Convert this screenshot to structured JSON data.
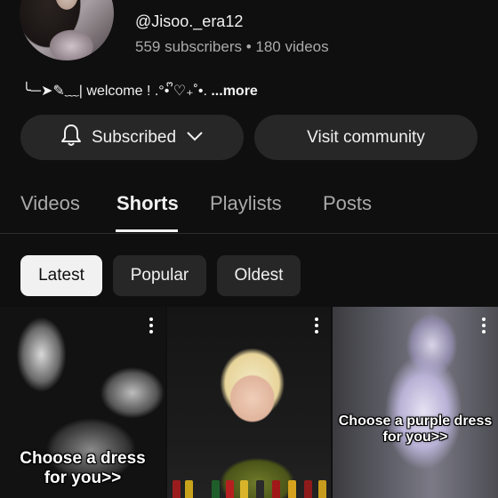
{
  "channel": {
    "handle": "@Jisoo._era12",
    "stats": "559 subscribers • 180 videos",
    "description": "╰─➤✎﹏| welcome ! .°• ᩚ♡₊˚•. ",
    "more_label": "...more"
  },
  "actions": {
    "subscribed_label": "Subscribed",
    "community_label": "Visit community"
  },
  "tabs": [
    {
      "label": "Videos",
      "active": false
    },
    {
      "label": "Shorts",
      "active": true
    },
    {
      "label": "Playlists",
      "active": false
    },
    {
      "label": "Posts",
      "active": false
    }
  ],
  "filters": [
    {
      "label": "Latest",
      "active": true
    },
    {
      "label": "Popular",
      "active": false
    },
    {
      "label": "Oldest",
      "active": false
    }
  ],
  "shorts": [
    {
      "caption_line1": "Choose a dress",
      "caption_line2": "for you>>"
    },
    {
      "caption_line1": "",
      "caption_line2": ""
    },
    {
      "caption_line1": "Choose a purple dress",
      "caption_line2": "for you>>"
    }
  ],
  "icons": {
    "subscribed": "bell-icon",
    "dropdown": "chevron-down-icon",
    "menu": "more-vert-icon"
  },
  "colors": {
    "background": "#0f0f0f",
    "chip": "#272727",
    "active_chip": "#f1f1f1",
    "secondary_text": "#aaaaaa"
  }
}
